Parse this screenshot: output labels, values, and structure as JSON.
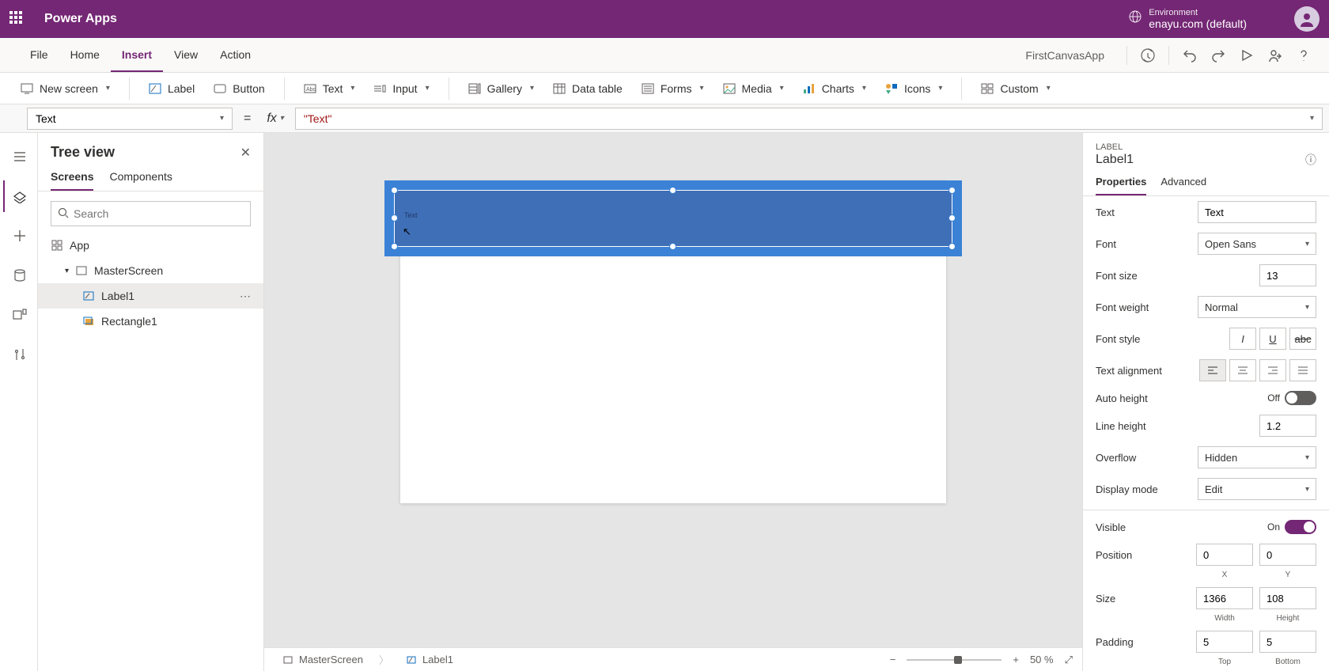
{
  "header": {
    "product": "Power Apps",
    "env_label": "Environment",
    "env_name": "enayu.com (default)"
  },
  "menubar": {
    "items": [
      "File",
      "Home",
      "Insert",
      "View",
      "Action"
    ],
    "active": "Insert",
    "app_name": "FirstCanvasApp"
  },
  "ribbon": {
    "new_screen": "New screen",
    "label": "Label",
    "button": "Button",
    "text": "Text",
    "input": "Input",
    "gallery": "Gallery",
    "data_table": "Data table",
    "forms": "Forms",
    "media": "Media",
    "charts": "Charts",
    "icons": "Icons",
    "custom": "Custom"
  },
  "fxbar": {
    "property": "Text",
    "formula": "\"Text\""
  },
  "tree": {
    "title": "Tree view",
    "tabs": [
      "Screens",
      "Components"
    ],
    "search_placeholder": "Search",
    "app": "App",
    "screen": "MasterScreen",
    "items": [
      {
        "name": "Label1",
        "icon": "label",
        "selected": true
      },
      {
        "name": "Rectangle1",
        "icon": "rect",
        "selected": false
      }
    ]
  },
  "canvas": {
    "label_text": "Text"
  },
  "status": {
    "crumbs": [
      "MasterScreen",
      "Label1"
    ],
    "zoom_pct": "50",
    "zoom_unit": "%"
  },
  "props": {
    "type": "LABEL",
    "name": "Label1",
    "tabs": [
      "Properties",
      "Advanced"
    ],
    "text_label": "Text",
    "text_val": "Text",
    "font_label": "Font",
    "font_val": "Open Sans",
    "fontsize_label": "Font size",
    "fontsize_val": "13",
    "weight_label": "Font weight",
    "weight_val": "Normal",
    "style_label": "Font style",
    "align_label": "Text alignment",
    "autoheight_label": "Auto height",
    "autoheight_state": "Off",
    "lineheight_label": "Line height",
    "lineheight_val": "1.2",
    "overflow_label": "Overflow",
    "overflow_val": "Hidden",
    "displaymode_label": "Display mode",
    "displaymode_val": "Edit",
    "visible_label": "Visible",
    "visible_state": "On",
    "position_label": "Position",
    "x": "0",
    "y": "0",
    "x_sub": "X",
    "y_sub": "Y",
    "size_label": "Size",
    "w": "1366",
    "h": "108",
    "w_sub": "Width",
    "h_sub": "Height",
    "padding_label": "Padding",
    "pt": "5",
    "pb": "5",
    "pt_sub": "Top",
    "pb_sub": "Bottom"
  }
}
